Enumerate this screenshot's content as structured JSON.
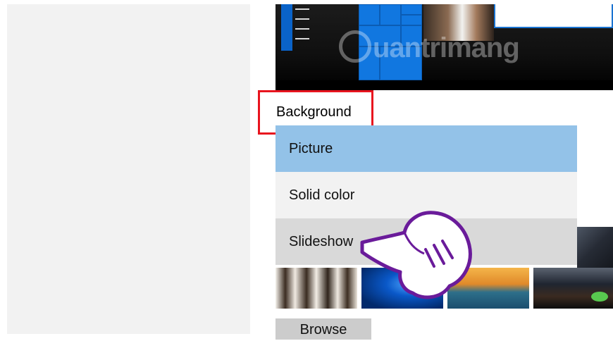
{
  "watermark": {
    "text": "uantrimang"
  },
  "background": {
    "label": "Background",
    "options": [
      {
        "label": "Picture",
        "state": "selected"
      },
      {
        "label": "Solid color",
        "state": "normal"
      },
      {
        "label": "Slideshow",
        "state": "hover"
      }
    ]
  },
  "browse": {
    "label": "Browse"
  },
  "colors": {
    "selected_option": "#93c2e8",
    "highlight_box": "#e8141e",
    "tile_blue": "#1177e0"
  }
}
